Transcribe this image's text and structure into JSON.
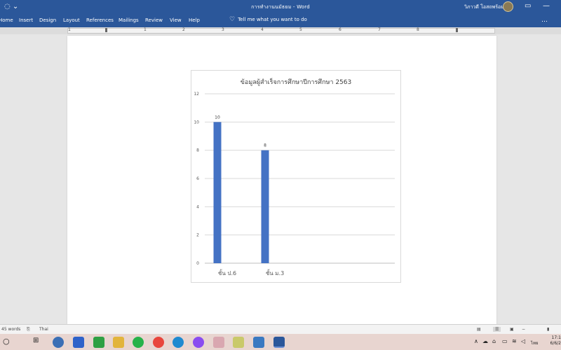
{
  "titlebar": {
    "document_title": "การทำงานนมัธยม - Word",
    "user_name": "วิภาวดี โอสถพร้อม",
    "restore_icon": "restore-icon",
    "minimize_icon": "minimize-icon"
  },
  "ribbon": {
    "tabs": [
      "Home",
      "Insert",
      "Design",
      "Layout",
      "References",
      "Mailings",
      "Review",
      "View",
      "Help"
    ],
    "tell_me": "Tell me what you want to do"
  },
  "ruler": {
    "numbers": [
      "1",
      "1",
      "2",
      "3",
      "4",
      "5",
      "6",
      "7",
      "8"
    ]
  },
  "chart_data": {
    "type": "bar",
    "title": "ข้อมูลผู้สำเร็จการศึกษาปีการศึกษา 2563",
    "categories": [
      "ชั้น ป.6",
      "ชั้น ม.3"
    ],
    "values": [
      10,
      8
    ],
    "data_labels": [
      "10",
      "8"
    ],
    "yticks": [
      "0",
      "2",
      "4",
      "6",
      "8",
      "10",
      "12"
    ],
    "ylim": [
      0,
      12
    ],
    "grid": true,
    "bar_color": "#4472c4"
  },
  "statusbar": {
    "word_count": "45 words",
    "language": "Thai"
  },
  "taskbar": {
    "clock_time": "17:1",
    "clock_date": "6/6/2"
  }
}
